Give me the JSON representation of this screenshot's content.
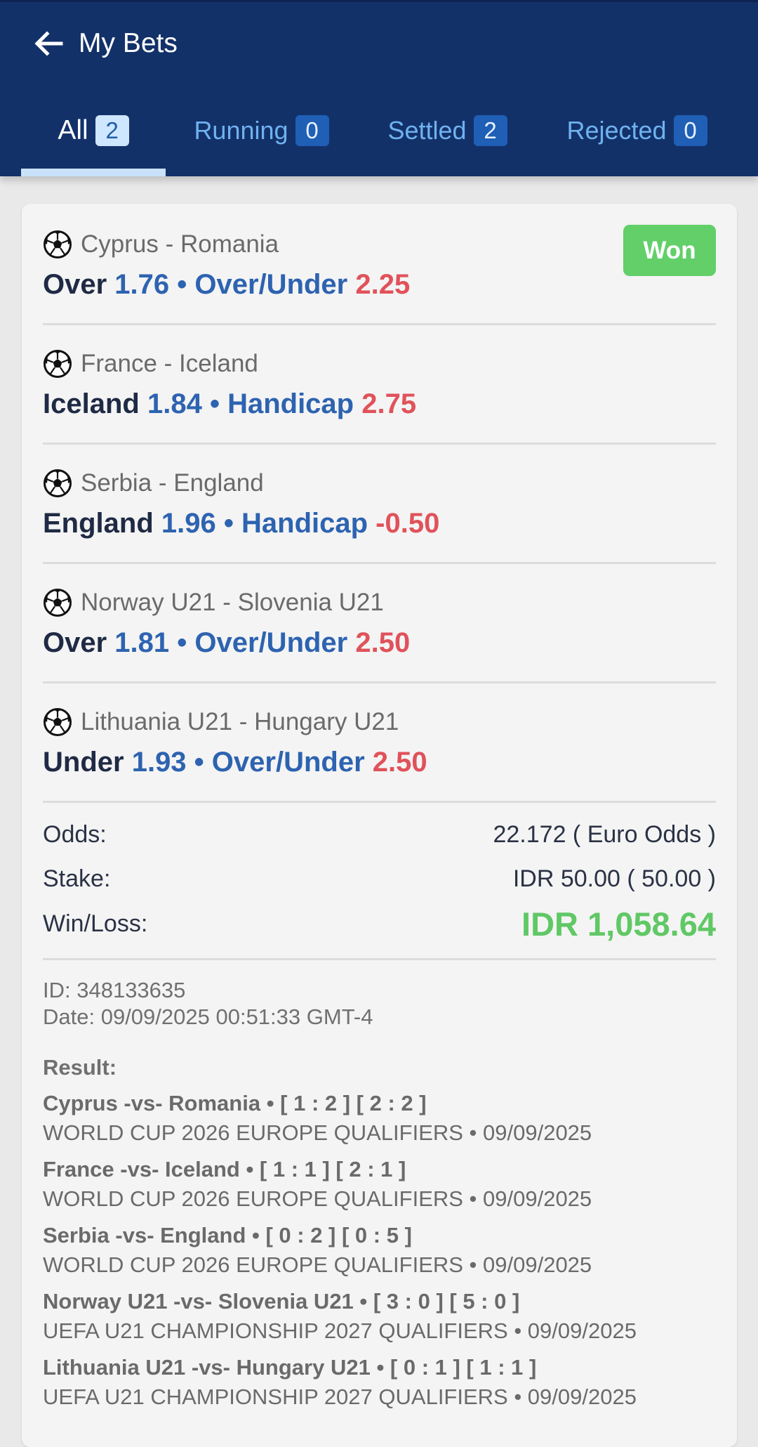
{
  "header": {
    "title": "My Bets",
    "back_icon": "arrow-left-icon"
  },
  "tabs": [
    {
      "label": "All",
      "count": "2",
      "active": true
    },
    {
      "label": "Running",
      "count": "0",
      "active": false
    },
    {
      "label": "Settled",
      "count": "2",
      "active": false
    },
    {
      "label": "Rejected",
      "count": "0",
      "active": false
    }
  ],
  "bet": {
    "status": "Won",
    "legs": [
      {
        "match": "Cyprus - Romania",
        "selection": "Over",
        "odds": "1.76",
        "market": "Over/Under",
        "line": "2.25"
      },
      {
        "match": "France - Iceland",
        "selection": "Iceland",
        "odds": "1.84",
        "market": "Handicap",
        "line": "2.75"
      },
      {
        "match": "Serbia - England",
        "selection": "England",
        "odds": "1.96",
        "market": "Handicap",
        "line": "-0.50"
      },
      {
        "match": "Norway U21 - Slovenia U21",
        "selection": "Over",
        "odds": "1.81",
        "market": "Over/Under",
        "line": "2.50"
      },
      {
        "match": "Lithuania U21 - Hungary U21",
        "selection": "Under",
        "odds": "1.93",
        "market": "Over/Under",
        "line": "2.50"
      }
    ],
    "summary": {
      "odds_label": "Odds:",
      "odds_value": "22.172 ( Euro Odds )",
      "stake_label": "Stake:",
      "stake_value": "IDR 50.00 ( 50.00 )",
      "winloss_label": "Win/Loss:",
      "winloss_value": "IDR 1,058.64"
    },
    "id_text": "ID: 348133635",
    "date_text": "Date: 09/09/2025 00:51:33 GMT-4",
    "result_title": "Result:",
    "results": [
      {
        "line1": "Cyprus -vs- Romania • [ 1 : 2 ] [ 2 : 2 ]",
        "line2": "WORLD CUP 2026 EUROPE QUALIFIERS • 09/09/2025"
      },
      {
        "line1": "France -vs- Iceland • [ 1 : 1 ] [ 2 : 1 ]",
        "line2": "WORLD CUP 2026 EUROPE QUALIFIERS • 09/09/2025"
      },
      {
        "line1": "Serbia -vs- England • [ 0 : 2 ] [ 0 : 5 ]",
        "line2": "WORLD CUP 2026 EUROPE QUALIFIERS • 09/09/2025"
      },
      {
        "line1": "Norway U21 -vs- Slovenia U21 • [ 3 : 0 ] [ 5 : 0 ]",
        "line2": "UEFA U21 CHAMPIONSHIP 2027 QUALIFIERS • 09/09/2025"
      },
      {
        "line1": "Lithuania U21 -vs- Hungary U21 • [ 0 : 1 ] [ 1 : 1 ]",
        "line2": "UEFA U21 CHAMPIONSHIP 2027 QUALIFIERS • 09/09/2025"
      }
    ]
  }
}
